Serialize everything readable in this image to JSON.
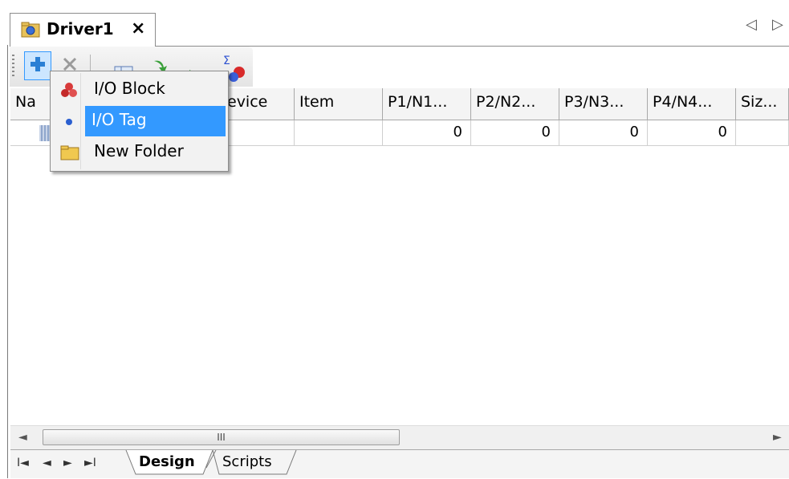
{
  "document_tab": {
    "title": "Driver1",
    "close_symbol": "×",
    "icon": "driver-folder-icon"
  },
  "tab_nav": {
    "left_symbol": "◁",
    "right_symbol": "▷"
  },
  "toolbar": {
    "buttons": [
      {
        "name": "add-button",
        "icon": "plus-icon",
        "enabled": true
      },
      {
        "name": "delete-button",
        "icon": "x-icon",
        "enabled": false
      },
      {
        "name": "properties-button",
        "icon": "grid-icon"
      },
      {
        "name": "move-button",
        "icon": "move-icon"
      },
      {
        "name": "run-button",
        "icon": "play-icon"
      },
      {
        "name": "sum-button",
        "icon": "sigma-icon"
      }
    ]
  },
  "grid": {
    "columns": [
      "Na",
      "evice",
      "Item",
      "P1/N1...",
      "P2/N2...",
      "P3/N3...",
      "P4/N4...",
      "Siz..."
    ],
    "rows": [
      {
        "cells": [
          "",
          "",
          "",
          "0",
          "0",
          "0",
          "0",
          ""
        ]
      }
    ]
  },
  "context_menu": {
    "items": [
      {
        "label": "I/O Block",
        "icon": "io-block-icon",
        "selected": false
      },
      {
        "label": "I/O Tag",
        "icon": "io-tag-icon",
        "selected": true
      },
      {
        "label": "New Folder",
        "icon": "folder-icon",
        "selected": false
      }
    ]
  },
  "scrollbar": {
    "left_symbol": "◄",
    "right_symbol": "►",
    "thumb_grip": "III"
  },
  "bottom_tabs": {
    "nav": [
      "I◄",
      "◄",
      "►",
      "►I"
    ],
    "tabs": [
      {
        "label": "Design",
        "active": true
      },
      {
        "label": "Scripts",
        "active": false
      }
    ]
  },
  "colors": {
    "selection": "#3399ff",
    "accent_add": "#2a7fd4"
  }
}
